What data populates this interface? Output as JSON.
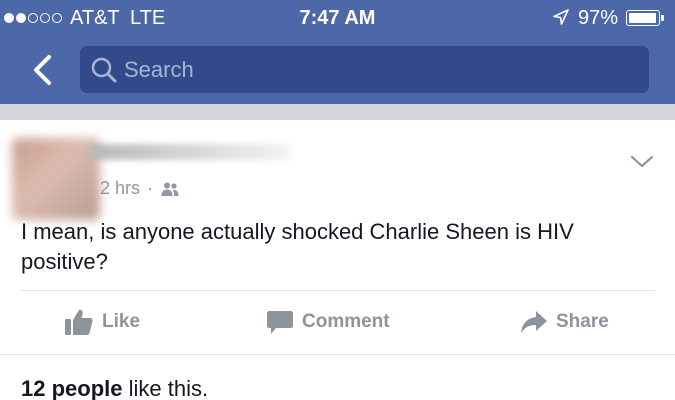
{
  "status_bar": {
    "signal_strength": {
      "filled": 2,
      "total": 5
    },
    "carrier": "AT&T",
    "network": "LTE",
    "time": "7:47 AM",
    "location_icon": "location-arrow-icon",
    "battery_percent": "97%",
    "battery_level": 0.97
  },
  "nav": {
    "back_icon": "chevron-left-icon",
    "search_icon": "search-icon",
    "search_placeholder": "Search"
  },
  "post": {
    "time": "2 hrs",
    "separator": "·",
    "audience_icon": "friends-icon",
    "menu_icon": "chevron-down-icon",
    "text": "I mean, is anyone actually shocked Charlie Sheen is HIV positive?",
    "actions": {
      "like": "Like",
      "comment": "Comment",
      "share": "Share"
    },
    "likes": {
      "count": "12 people",
      "suffix": " like this."
    }
  },
  "colors": {
    "brand_blue": "#4c68a8",
    "search_bg": "#32498a",
    "text_dark": "#141823",
    "text_muted": "#9197a3",
    "action_gray": "#8d949e"
  }
}
